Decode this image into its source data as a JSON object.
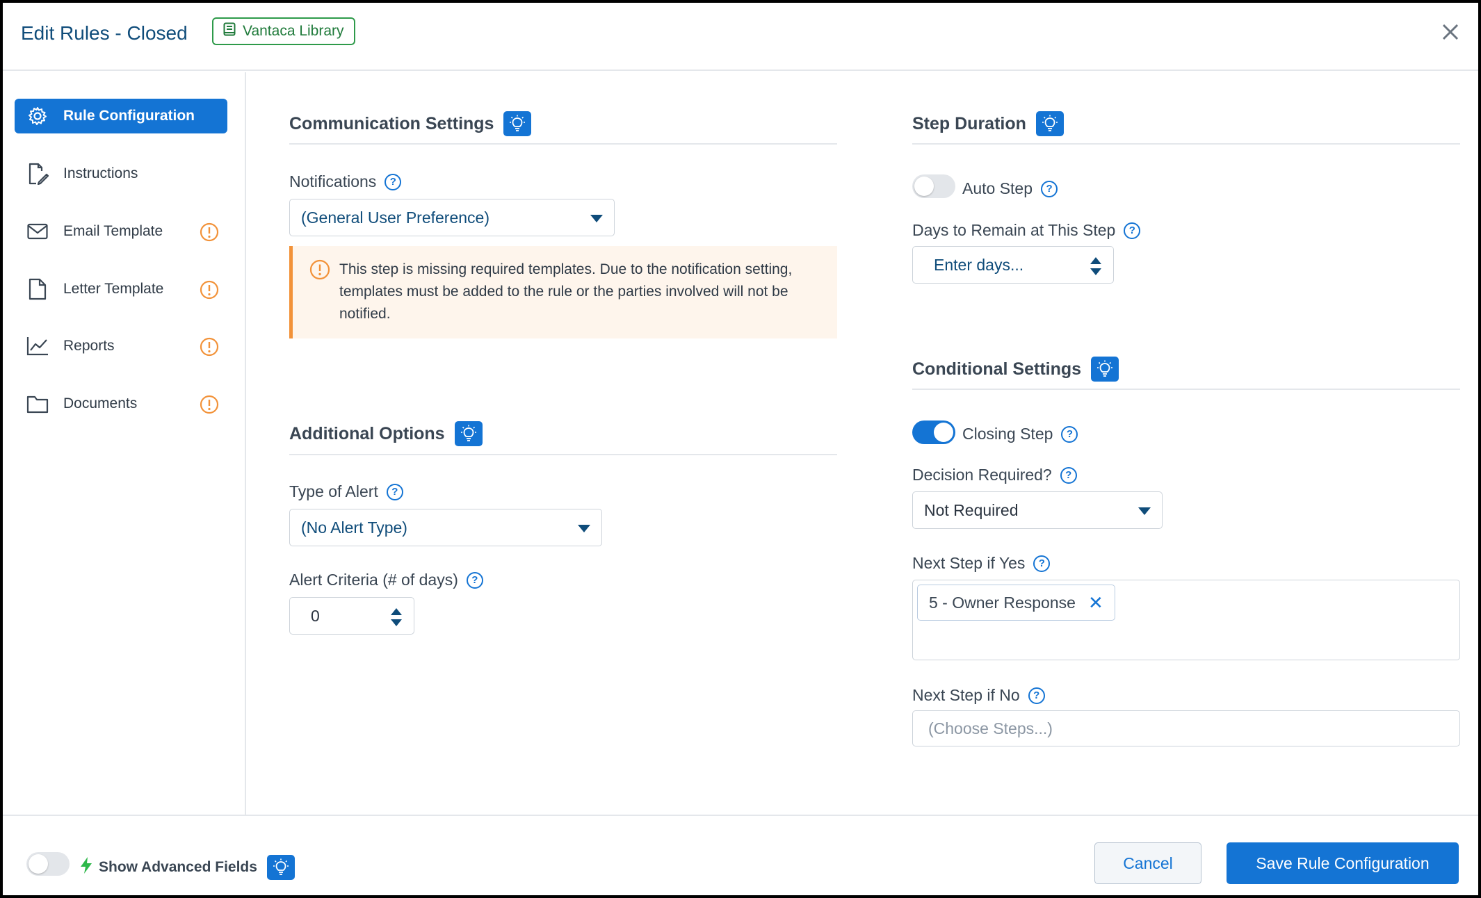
{
  "header": {
    "title": "Edit Rules - Closed",
    "library_badge": "Vantaca Library"
  },
  "sidebar": {
    "items": [
      {
        "label": "Rule Configuration",
        "icon": "gear-icon",
        "active": true,
        "warning": false
      },
      {
        "label": "Instructions",
        "icon": "edit-document-icon",
        "active": false,
        "warning": false
      },
      {
        "label": "Email Template",
        "icon": "envelope-icon",
        "active": false,
        "warning": true
      },
      {
        "label": "Letter Template",
        "icon": "document-icon",
        "active": false,
        "warning": true
      },
      {
        "label": "Reports",
        "icon": "line-chart-icon",
        "active": false,
        "warning": true
      },
      {
        "label": "Documents",
        "icon": "folder-icon",
        "active": false,
        "warning": true
      }
    ]
  },
  "communication": {
    "title": "Communication Settings",
    "notifications_label": "Notifications",
    "notifications_value": "(General User Preference)",
    "alert_text": "This step is missing required templates. Due to the notification setting, templates must be added to the rule or the parties involved will not be notified."
  },
  "additional": {
    "title": "Additional Options",
    "alert_type_label": "Type of Alert",
    "alert_type_value": "(No Alert Type)",
    "alert_criteria_label": "Alert Criteria (# of days)",
    "alert_criteria_value": "0"
  },
  "step_duration": {
    "title": "Step Duration",
    "auto_step_label": "Auto Step",
    "auto_step_on": false,
    "days_label": "Days to Remain at This Step",
    "days_placeholder": "Enter days..."
  },
  "conditional": {
    "title": "Conditional Settings",
    "closing_step_label": "Closing Step",
    "closing_step_on": true,
    "decision_label": "Decision Required?",
    "decision_value": "Not Required",
    "next_yes_label": "Next Step if Yes",
    "next_yes_chip": "5 - Owner Response",
    "next_no_label": "Next Step if No",
    "next_no_placeholder": "(Choose Steps...)"
  },
  "footer": {
    "advanced_label": "Show Advanced Fields",
    "advanced_on": false,
    "cancel_label": "Cancel",
    "save_label": "Save Rule Configuration"
  },
  "colors": {
    "primary": "#1474d4",
    "title_blue": "#0f4c7a",
    "warning_orange": "#f29239",
    "library_green": "#2e9a4a",
    "advanced_bolt": "#2eb84a"
  }
}
